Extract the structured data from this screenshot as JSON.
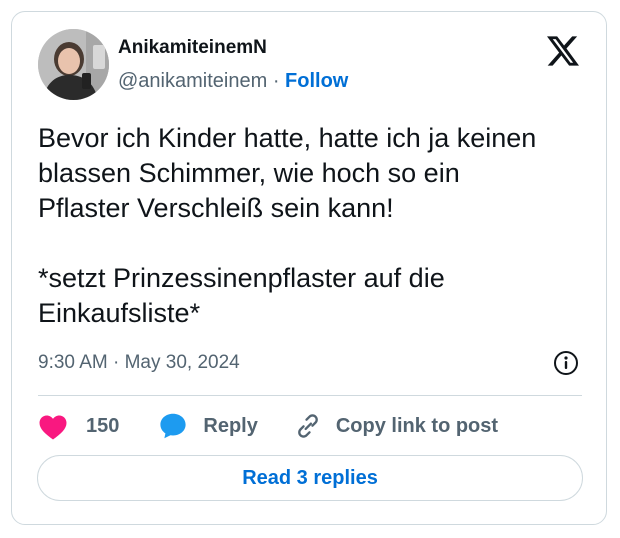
{
  "author": {
    "display_name": "AnikamiteinemN",
    "handle": "@anikamiteinem",
    "separator": "·",
    "follow_label": "Follow"
  },
  "tweet": {
    "lines": [
      "Bevor ich Kinder hatte, hatte ich ja keinen",
      "blassen Schimmer, wie hoch so ein",
      "Pflaster Verschleiß sein kann!",
      "*setzt Prinzessinenpflaster auf die",
      "Einkaufsliste*"
    ],
    "timestamp": "9:30 AM · May 30, 2024"
  },
  "actions": {
    "like_count": "150",
    "reply_label": "Reply",
    "copy_link_label": "Copy link to post"
  },
  "read_replies_label": "Read 3 replies",
  "icons": {
    "brand": "x-logo-icon",
    "info": "info-icon",
    "like": "heart-icon",
    "reply": "speech-bubble-icon",
    "copy": "link-icon"
  },
  "colors": {
    "heart": "#f91880",
    "reply_bubble": "#1d9bf0",
    "link_blue": "#006fd6",
    "secondary_text": "#536471",
    "border": "#cfd9de"
  }
}
